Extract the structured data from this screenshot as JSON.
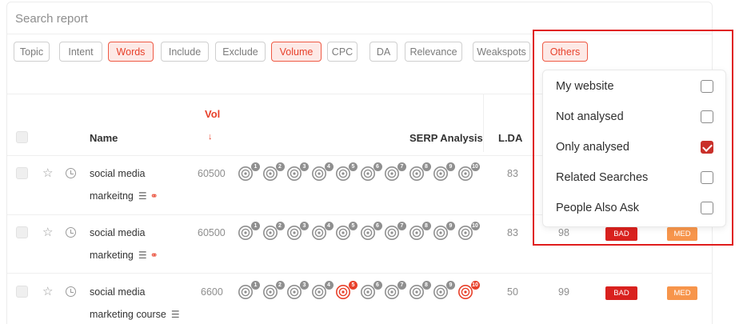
{
  "search": {
    "placeholder": "Search report"
  },
  "filters": [
    {
      "label": "Topic",
      "active": false
    },
    {
      "label": "Intent",
      "active": false
    },
    {
      "label": "Words",
      "active": true
    },
    {
      "label": "Include",
      "active": false
    },
    {
      "label": "Exclude",
      "active": false
    },
    {
      "label": "Volume",
      "active": true
    },
    {
      "label": "CPC",
      "active": false
    },
    {
      "label": "DA",
      "active": false
    },
    {
      "label": "Relevance",
      "active": false
    },
    {
      "label": "Weakspots",
      "active": false
    },
    {
      "label": "Others",
      "active": true
    }
  ],
  "table": {
    "headers": {
      "name": "Name",
      "vol": "Vol",
      "vol_sort": "↓",
      "serp": "SERP Analysis",
      "lda": "L.DA"
    },
    "rows": [
      {
        "keyword_line1": "social media",
        "keyword_line2": "markeitng",
        "has_link": true,
        "volume": "60500",
        "lda": "83",
        "col6": "",
        "bad": "",
        "med": "",
        "red_serp": []
      },
      {
        "keyword_line1": "social media",
        "keyword_line2": "marketing",
        "has_link": true,
        "volume": "60500",
        "lda": "83",
        "col6": "98",
        "bad": "BAD",
        "med": "MED",
        "red_serp": []
      },
      {
        "keyword_line1": "social media",
        "keyword_line2": "marketing course",
        "has_link": false,
        "volume": "6600",
        "lda": "50",
        "col6": "99",
        "bad": "BAD",
        "med": "MED",
        "red_serp": [
          5,
          10
        ]
      }
    ],
    "serp_badges": [
      "1",
      "2",
      "3",
      "4",
      "5",
      "6",
      "7",
      "8",
      "9",
      "10"
    ]
  },
  "others_dropdown": {
    "options": [
      {
        "label": "My website",
        "checked": false
      },
      {
        "label": "Not analysed",
        "checked": false
      },
      {
        "label": "Only analysed",
        "checked": true
      },
      {
        "label": "Related Searches",
        "checked": false
      },
      {
        "label": "People Also Ask",
        "checked": false
      }
    ]
  },
  "colors": {
    "accent": "#e8412b",
    "bad": "#d9211e",
    "med": "#f7954b",
    "highlight": "#e01d1d"
  },
  "icons": {
    "star": "star-icon",
    "clock": "clock-icon",
    "list": "list-icon",
    "link": "link-icon",
    "serp": "target-icon"
  }
}
